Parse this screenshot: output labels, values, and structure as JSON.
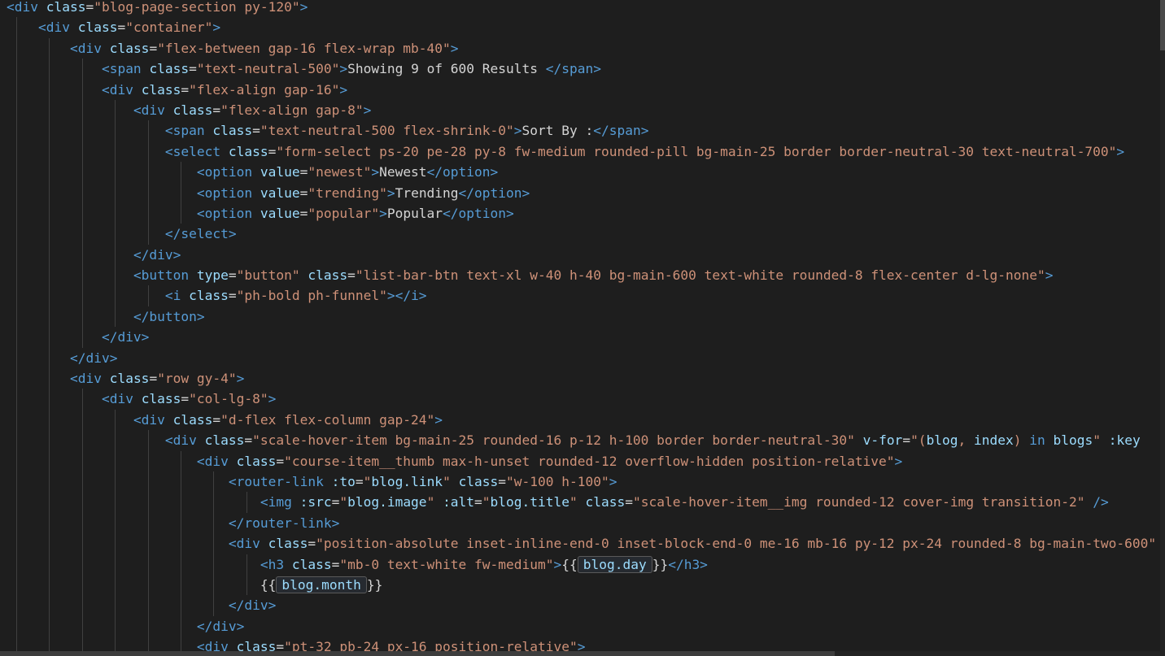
{
  "editor": {
    "lines": [
      {
        "indent": 0,
        "tokens": [
          [
            "tag",
            "<div "
          ],
          [
            "attr",
            "class"
          ],
          [
            "text",
            "="
          ],
          [
            "str",
            "\"blog-page-section py-120\""
          ],
          [
            "tag",
            ">"
          ]
        ]
      },
      {
        "indent": 1,
        "tokens": [
          [
            "tag",
            "<div "
          ],
          [
            "attr",
            "class"
          ],
          [
            "text",
            "="
          ],
          [
            "str",
            "\"container\""
          ],
          [
            "tag",
            ">"
          ]
        ]
      },
      {
        "indent": 2,
        "tokens": [
          [
            "tag",
            "<div "
          ],
          [
            "attr",
            "class"
          ],
          [
            "text",
            "="
          ],
          [
            "str",
            "\"flex-between gap-16 flex-wrap mb-40\""
          ],
          [
            "tag",
            ">"
          ]
        ]
      },
      {
        "indent": 3,
        "tokens": [
          [
            "tag",
            "<span "
          ],
          [
            "attr",
            "class"
          ],
          [
            "text",
            "="
          ],
          [
            "str",
            "\"text-neutral-500\""
          ],
          [
            "tag",
            ">"
          ],
          [
            "text",
            "Showing 9 of 600 Results "
          ],
          [
            "tag",
            "</span>"
          ]
        ]
      },
      {
        "indent": 3,
        "tokens": [
          [
            "tag",
            "<div "
          ],
          [
            "attr",
            "class"
          ],
          [
            "text",
            "="
          ],
          [
            "str",
            "\"flex-align gap-16\""
          ],
          [
            "tag",
            ">"
          ]
        ]
      },
      {
        "indent": 4,
        "tokens": [
          [
            "tag",
            "<div "
          ],
          [
            "attr",
            "class"
          ],
          [
            "text",
            "="
          ],
          [
            "str",
            "\"flex-align gap-8\""
          ],
          [
            "tag",
            ">"
          ]
        ]
      },
      {
        "indent": 5,
        "tokens": [
          [
            "tag",
            "<span "
          ],
          [
            "attr",
            "class"
          ],
          [
            "text",
            "="
          ],
          [
            "str",
            "\"text-neutral-500 flex-shrink-0\""
          ],
          [
            "tag",
            ">"
          ],
          [
            "text",
            "Sort By :"
          ],
          [
            "tag",
            "</span>"
          ]
        ]
      },
      {
        "indent": 5,
        "tokens": [
          [
            "tag",
            "<select "
          ],
          [
            "attr",
            "class"
          ],
          [
            "text",
            "="
          ],
          [
            "str",
            "\"form-select ps-20 pe-28 py-8 fw-medium rounded-pill bg-main-25 border border-neutral-30 text-neutral-700\""
          ],
          [
            "tag",
            ">"
          ]
        ]
      },
      {
        "indent": 6,
        "tokens": [
          [
            "tag",
            "<option "
          ],
          [
            "attr",
            "value"
          ],
          [
            "text",
            "="
          ],
          [
            "str",
            "\"newest\""
          ],
          [
            "tag",
            ">"
          ],
          [
            "text",
            "Newest"
          ],
          [
            "tag",
            "</option>"
          ]
        ]
      },
      {
        "indent": 6,
        "tokens": [
          [
            "tag",
            "<option "
          ],
          [
            "attr",
            "value"
          ],
          [
            "text",
            "="
          ],
          [
            "str",
            "\"trending\""
          ],
          [
            "tag",
            ">"
          ],
          [
            "text",
            "Trending"
          ],
          [
            "tag",
            "</option>"
          ]
        ]
      },
      {
        "indent": 6,
        "tokens": [
          [
            "tag",
            "<option "
          ],
          [
            "attr",
            "value"
          ],
          [
            "text",
            "="
          ],
          [
            "str",
            "\"popular\""
          ],
          [
            "tag",
            ">"
          ],
          [
            "text",
            "Popular"
          ],
          [
            "tag",
            "</option>"
          ]
        ]
      },
      {
        "indent": 5,
        "tokens": [
          [
            "tag",
            "</select>"
          ]
        ]
      },
      {
        "indent": 4,
        "tokens": [
          [
            "tag",
            "</div>"
          ]
        ]
      },
      {
        "indent": 4,
        "tokens": [
          [
            "tag",
            "<button "
          ],
          [
            "attr",
            "type"
          ],
          [
            "text",
            "="
          ],
          [
            "str",
            "\"button\""
          ],
          [
            "text",
            " "
          ],
          [
            "attr",
            "class"
          ],
          [
            "text",
            "="
          ],
          [
            "str",
            "\"list-bar-btn text-xl w-40 h-40 bg-main-600 text-white rounded-8 flex-center d-lg-none\""
          ],
          [
            "tag",
            ">"
          ]
        ]
      },
      {
        "indent": 5,
        "tokens": [
          [
            "tag",
            "<i "
          ],
          [
            "attr",
            "class"
          ],
          [
            "text",
            "="
          ],
          [
            "str",
            "\"ph-bold ph-funnel\""
          ],
          [
            "tag",
            "></i>"
          ]
        ]
      },
      {
        "indent": 4,
        "tokens": [
          [
            "tag",
            "</button>"
          ]
        ]
      },
      {
        "indent": 3,
        "tokens": [
          [
            "tag",
            "</div>"
          ]
        ]
      },
      {
        "indent": 2,
        "tokens": [
          [
            "tag",
            "</div>"
          ]
        ]
      },
      {
        "indent": 2,
        "tokens": [
          [
            "tag",
            "<div "
          ],
          [
            "attr",
            "class"
          ],
          [
            "text",
            "="
          ],
          [
            "str",
            "\"row gy-4\""
          ],
          [
            "tag",
            ">"
          ]
        ]
      },
      {
        "indent": 3,
        "tokens": [
          [
            "tag",
            "<div "
          ],
          [
            "attr",
            "class"
          ],
          [
            "text",
            "="
          ],
          [
            "str",
            "\"col-lg-8\""
          ],
          [
            "tag",
            ">"
          ]
        ]
      },
      {
        "indent": 4,
        "tokens": [
          [
            "tag",
            "<div "
          ],
          [
            "attr",
            "class"
          ],
          [
            "text",
            "="
          ],
          [
            "str",
            "\"d-flex flex-column gap-24\""
          ],
          [
            "tag",
            ">"
          ]
        ]
      },
      {
        "indent": 5,
        "tokens": [
          [
            "tag",
            "<div "
          ],
          [
            "attr",
            "class"
          ],
          [
            "text",
            "="
          ],
          [
            "str",
            "\"scale-hover-item bg-main-25 rounded-16 p-12 h-100 border border-neutral-30\""
          ],
          [
            "text",
            " "
          ],
          [
            "attr",
            "v-for"
          ],
          [
            "text",
            "="
          ],
          [
            "str",
            "\"("
          ],
          [
            "strexpr",
            "blog"
          ],
          [
            "str",
            ", "
          ],
          [
            "strexpr",
            "index"
          ],
          [
            "str",
            ") "
          ],
          [
            "kw",
            "in"
          ],
          [
            "str",
            " "
          ],
          [
            "strexpr",
            "blogs"
          ],
          [
            "str",
            "\""
          ],
          [
            "text",
            " "
          ],
          [
            "attr",
            ":key"
          ]
        ]
      },
      {
        "indent": 6,
        "tokens": [
          [
            "tag",
            "<div "
          ],
          [
            "attr",
            "class"
          ],
          [
            "text",
            "="
          ],
          [
            "str",
            "\"course-item__thumb max-h-unset rounded-12 overflow-hidden position-relative\""
          ],
          [
            "tag",
            ">"
          ]
        ]
      },
      {
        "indent": 7,
        "tokens": [
          [
            "tag",
            "<router-link "
          ],
          [
            "attr",
            ":to"
          ],
          [
            "text",
            "="
          ],
          [
            "str",
            "\""
          ],
          [
            "strexpr",
            "blog.link"
          ],
          [
            "str",
            "\""
          ],
          [
            "text",
            " "
          ],
          [
            "attr",
            "class"
          ],
          [
            "text",
            "="
          ],
          [
            "str",
            "\"w-100 h-100\""
          ],
          [
            "tag",
            ">"
          ]
        ]
      },
      {
        "indent": 8,
        "tokens": [
          [
            "tag",
            "<img "
          ],
          [
            "attr",
            ":src"
          ],
          [
            "text",
            "="
          ],
          [
            "str",
            "\""
          ],
          [
            "strexpr",
            "blog.image"
          ],
          [
            "str",
            "\""
          ],
          [
            "text",
            " "
          ],
          [
            "attr",
            ":alt"
          ],
          [
            "text",
            "="
          ],
          [
            "str",
            "\""
          ],
          [
            "strexpr",
            "blog.title"
          ],
          [
            "str",
            "\""
          ],
          [
            "text",
            " "
          ],
          [
            "attr",
            "class"
          ],
          [
            "text",
            "="
          ],
          [
            "str",
            "\"scale-hover-item__img rounded-12 cover-img transition-2\""
          ],
          [
            "text",
            " "
          ],
          [
            "tag",
            "/>"
          ]
        ]
      },
      {
        "indent": 7,
        "tokens": [
          [
            "tag",
            "</router-link>"
          ]
        ]
      },
      {
        "indent": 7,
        "tokens": [
          [
            "tag",
            "<div "
          ],
          [
            "attr",
            "class"
          ],
          [
            "text",
            "="
          ],
          [
            "str",
            "\"position-absolute inset-inline-end-0 inset-block-end-0 me-16 mb-16 py-12 px-24 rounded-8 bg-main-two-600\""
          ]
        ]
      },
      {
        "indent": 8,
        "tokens": [
          [
            "tag",
            "<h3 "
          ],
          [
            "attr",
            "class"
          ],
          [
            "text",
            "="
          ],
          [
            "str",
            "\"mb-0 text-white fw-medium\""
          ],
          [
            "tag",
            ">"
          ],
          [
            "text",
            "{{"
          ],
          [
            "hl",
            "blog.day"
          ],
          [
            "text",
            "}}"
          ],
          [
            "tag",
            "</h3>"
          ]
        ]
      },
      {
        "indent": 8,
        "tokens": [
          [
            "text",
            "{{"
          ],
          [
            "hl",
            "blog.month"
          ],
          [
            "text",
            "}}"
          ]
        ]
      },
      {
        "indent": 7,
        "tokens": [
          [
            "tag",
            "</div>"
          ]
        ]
      },
      {
        "indent": 6,
        "tokens": [
          [
            "tag",
            "</div>"
          ]
        ]
      },
      {
        "indent": 6,
        "tokens": [
          [
            "tag",
            "<div "
          ],
          [
            "attr",
            "class"
          ],
          [
            "text",
            "="
          ],
          [
            "str",
            "\"pt-32 pb-24 px-16 position-relative\""
          ],
          [
            "tag",
            ">"
          ]
        ]
      }
    ]
  },
  "colors": {
    "background": "#1e1e1e",
    "tag": "#569cd6",
    "attribute": "#9cdcfe",
    "string": "#ce9178",
    "text": "#d4d4d4"
  }
}
